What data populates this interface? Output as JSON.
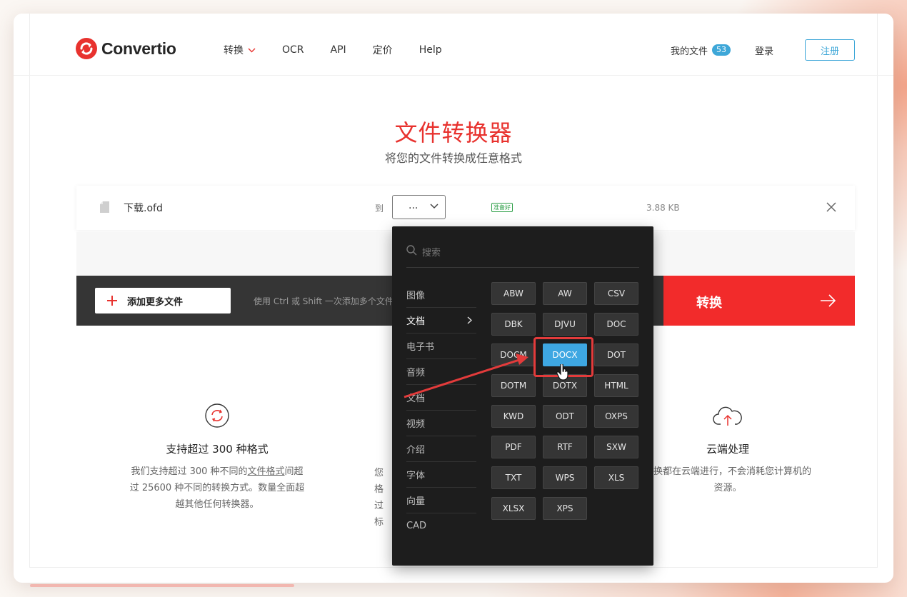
{
  "header": {
    "logo_text": "Convertio",
    "nav": [
      "转换",
      "OCR",
      "API",
      "定价",
      "Help"
    ],
    "my_files_label": "我的文件",
    "my_files_count": "53",
    "login_label": "登录",
    "register_label": "注册"
  },
  "hero": {
    "title": "文件转换器",
    "subtitle": "将您的文件转换成任意格式"
  },
  "file": {
    "name": "下载.ofd",
    "to_label": "到",
    "selected_format": "...",
    "status": "准备好",
    "size": "3.88 KB"
  },
  "actions": {
    "add_more_label": "添加更多文件",
    "hint": "使用 Ctrl 或 Shift 一次添加多个文件",
    "convert_label": "转换"
  },
  "features": {
    "left": {
      "title": "支持超过 300 种格式",
      "desc_prefix": "我们支持超过 300 种不同的",
      "desc_link": "文件格式",
      "desc_rest": "间超过 25600 种不同的转换方式。数量全面超越其他任何转换器。"
    },
    "middle_fragments": [
      "您",
      "格",
      "过",
      "标"
    ],
    "right": {
      "title": "云端处理",
      "desc": "转换都在云端进行，不会消耗您计算机的资源。"
    }
  },
  "dropdown": {
    "search_placeholder": "搜索",
    "categories": [
      "图像",
      "文档",
      "电子书",
      "音频",
      "文档",
      "视频",
      "介绍",
      "字体",
      "向量",
      "CAD"
    ],
    "active_category": "文档",
    "formats": [
      "ABW",
      "AW",
      "CSV",
      "DBK",
      "DJVU",
      "DOC",
      "DOCM",
      "DOCX",
      "DOT",
      "DOTM",
      "DOTX",
      "HTML",
      "KWD",
      "ODT",
      "OXPS",
      "PDF",
      "RTF",
      "SXW",
      "TXT",
      "WPS",
      "XLS",
      "XLSX",
      "XPS"
    ],
    "selected_format": "DOCX"
  },
  "colors": {
    "brand_red": "#e8322e",
    "convert_red": "#f22b2b",
    "accent_blue": "#3ea7e2",
    "dropdown_bg": "#1d1d1d",
    "action_bar_bg": "#353535"
  }
}
